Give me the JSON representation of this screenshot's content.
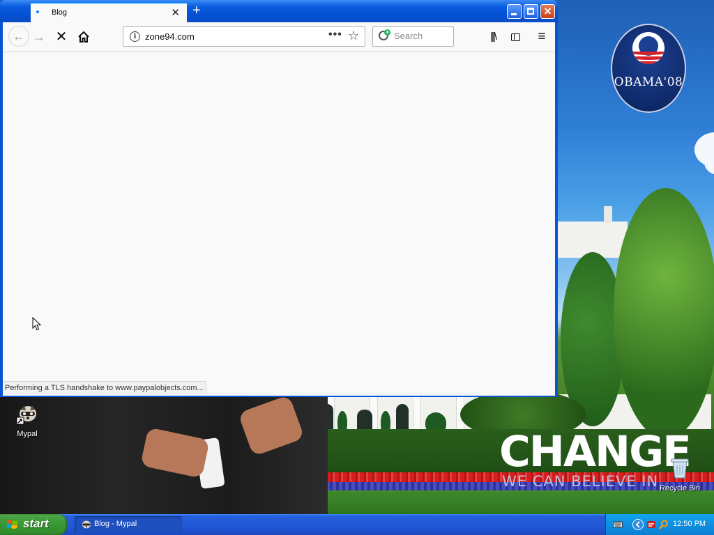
{
  "browser": {
    "tab": {
      "title": "Blog"
    },
    "url": "zone94.com",
    "search_placeholder": "Search",
    "status_text": "Performing a TLS handshake to www.paypalobjects.com..."
  },
  "desktop": {
    "icons": [
      {
        "label": "Mypal"
      },
      {
        "label": "Recycle Bin"
      }
    ],
    "wallpaper": {
      "headline": "CHANGE",
      "subline": "WE CAN BELIEVE IN",
      "badge_text": "OBAMA'08"
    }
  },
  "taskbar": {
    "start_label": "start",
    "task_items": [
      {
        "label": "Blog - Mypal"
      }
    ],
    "clock": "12:50 PM"
  },
  "colors": {
    "titlebar_blue": "#0a54d6",
    "taskbar_blue": "#245edb",
    "start_green": "#3c9a36",
    "tab_accent": "#0a84ff"
  },
  "icons": [
    "back-arrow-icon",
    "forward-arrow-icon",
    "stop-icon",
    "home-icon",
    "info-icon",
    "page-actions-icon",
    "bookmark-star-icon",
    "search-icon",
    "library-icon",
    "sidebar-icon",
    "menu-icon",
    "minimize-icon",
    "maximize-icon",
    "close-icon",
    "new-tab-icon",
    "windows-flag-icon"
  ]
}
